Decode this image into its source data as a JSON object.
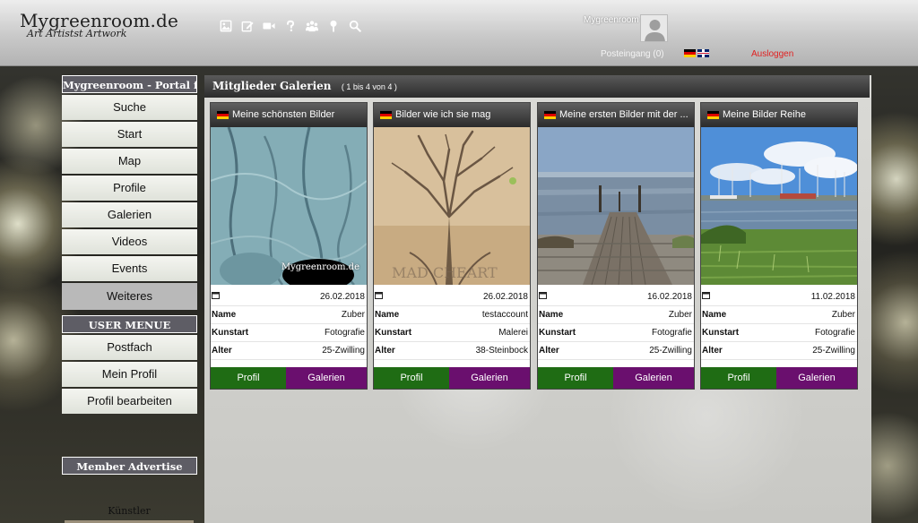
{
  "header": {
    "logo_title": "Mygreenroom.de",
    "logo_subtitle": "Art Artistst Artwork",
    "toolbar_icons": [
      "image-icon",
      "edit-icon",
      "video-icon",
      "question-icon",
      "group-icon",
      "map-pin-icon",
      "search-icon"
    ],
    "username": "Mygreenroom",
    "posteingang": "Posteingang (0)",
    "logout": "Ausloggen"
  },
  "sidebar": {
    "header": "Mygreenroom - Portal für",
    "items": [
      "Suche",
      "Start",
      "Map",
      "Profile",
      "Galerien",
      "Videos",
      "Events",
      "Weiteres"
    ],
    "user_menu_header": "USER MENUE",
    "user_items": [
      "Postfach",
      "Mein Profil",
      "Profil bearbeiten"
    ],
    "advertise_header": "Member Advertise",
    "kuenstler": "Künstler"
  },
  "main": {
    "title": "Mitglieder Galerien",
    "count": "( 1 bis 4 von 4 )",
    "labels": {
      "name": "Name",
      "kunstart": "Kunstart",
      "alter": "Alter"
    },
    "buttons": {
      "profil": "Profil",
      "galerien": "Galerien"
    },
    "watermark": "Mygreenroom.de",
    "cards": [
      {
        "title": "Meine schönsten Bilder",
        "date": "26.02.2018",
        "name": "Zuber",
        "kunstart": "Fotografie",
        "alter": "25-Zwilling"
      },
      {
        "title": "Bilder wie ich sie mag",
        "date": "26.02.2018",
        "name": "testaccount",
        "kunstart": "Malerei",
        "alter": "38-Steinbock"
      },
      {
        "title": "Meine ersten Bilder mit der ...",
        "date": "16.02.2018",
        "name": "Zuber",
        "kunstart": "Fotografie",
        "alter": "25-Zwilling"
      },
      {
        "title": "Meine Bilder Reihe",
        "date": "11.02.2018",
        "name": "Zuber",
        "kunstart": "Fotografie",
        "alter": "25-Zwilling"
      }
    ]
  },
  "colors": {
    "profil_button": "#1f6c14",
    "galerien_button": "#6a0f6e",
    "logout": "#e02020",
    "sidebar_header": "#5e5d65"
  }
}
